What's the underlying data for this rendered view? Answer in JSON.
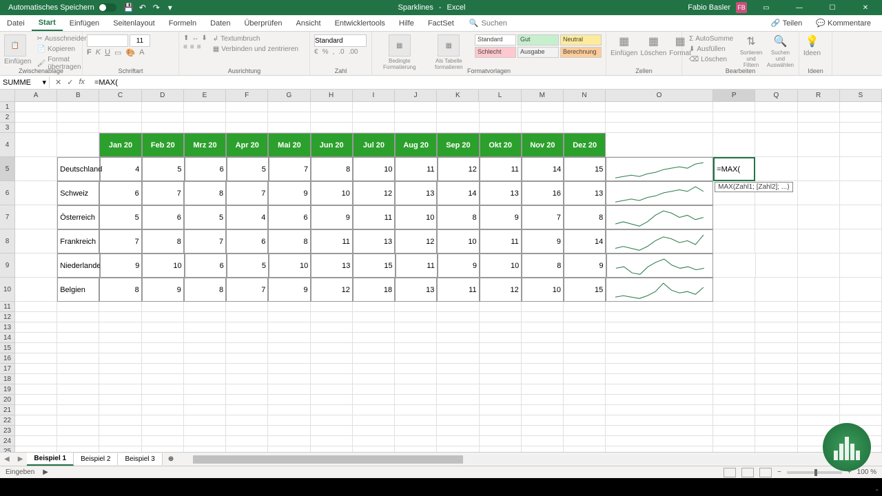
{
  "titlebar": {
    "autosave": "Automatisches Speichern",
    "doc_name": "Sparklines",
    "app_name": "Excel",
    "user_name": "Fabio Basler",
    "user_initials": "FB"
  },
  "ribbon_tabs": [
    "Datei",
    "Start",
    "Einfügen",
    "Seitenlayout",
    "Formeln",
    "Daten",
    "Überprüfen",
    "Ansicht",
    "Entwicklertools",
    "Hilfe",
    "FactSet"
  ],
  "ribbon_active_tab": "Start",
  "ribbon_search": "Suchen",
  "ribbon_share": "Teilen",
  "ribbon_comments": "Kommentare",
  "ribbon_groups": {
    "clipboard": {
      "label": "Zwischenablage",
      "paste": "Einfügen",
      "cut": "Ausschneiden",
      "copy": "Kopieren",
      "format_painter": "Format übertragen"
    },
    "font": {
      "label": "Schriftart",
      "size": "11"
    },
    "alignment": {
      "label": "Ausrichtung",
      "wrap": "Textumbruch",
      "merge": "Verbinden und zentrieren"
    },
    "number": {
      "label": "Zahl",
      "format": "Standard"
    },
    "styles": {
      "label": "Formatvorlagen",
      "conditional": "Bedingte Formatierung",
      "as_table": "Als Tabelle formatieren",
      "standard": "Standard",
      "gut": "Gut",
      "neutral": "Neutral",
      "schlecht": "Schlecht",
      "ausgabe": "Ausgabe",
      "berechnung": "Berechnung"
    },
    "cells": {
      "label": "Zellen",
      "insert": "Einfügen",
      "delete": "Löschen",
      "format": "Format"
    },
    "editing": {
      "label": "Bearbeiten",
      "autosum": "AutoSumme",
      "fill": "Ausfüllen",
      "clear": "Löschen",
      "sort": "Sortieren und Filtern",
      "find": "Suchen und Auswählen"
    },
    "ideas": {
      "label": "Ideen",
      "ideas": "Ideen"
    }
  },
  "name_box": "SUMME",
  "formula": "=MAX(",
  "formula_tooltip": "MAX(Zahl1; [Zahl2]; ...)",
  "columns": [
    "A",
    "B",
    "C",
    "D",
    "E",
    "F",
    "G",
    "H",
    "I",
    "J",
    "K",
    "L",
    "M",
    "N",
    "O",
    "P",
    "Q",
    "R",
    "S"
  ],
  "col_widths": {
    "A": 62,
    "B": 62,
    "C": 62,
    "D": 62,
    "E": 62,
    "F": 62,
    "G": 62,
    "H": 62,
    "I": 62,
    "J": 62,
    "K": 62,
    "L": 62,
    "M": 62,
    "N": 62,
    "O": 158,
    "P": 62,
    "Q": 62,
    "R": 62,
    "S": 62
  },
  "months": [
    "Jan 20",
    "Feb 20",
    "Mrz 20",
    "Apr 20",
    "Mai 20",
    "Jun 20",
    "Jul 20",
    "Aug 20",
    "Sep 20",
    "Okt 20",
    "Nov 20",
    "Dez 20"
  ],
  "chart_data": {
    "type": "line",
    "categories": [
      "Jan 20",
      "Feb 20",
      "Mrz 20",
      "Apr 20",
      "Mai 20",
      "Jun 20",
      "Jul 20",
      "Aug 20",
      "Sep 20",
      "Okt 20",
      "Nov 20",
      "Dez 20"
    ],
    "series": [
      {
        "name": "Deutschland",
        "values": [
          4,
          5,
          6,
          5,
          7,
          8,
          10,
          11,
          12,
          11,
          14,
          15
        ]
      },
      {
        "name": "Schweiz",
        "values": [
          6,
          7,
          8,
          7,
          9,
          10,
          12,
          13,
          14,
          13,
          16,
          13
        ]
      },
      {
        "name": "Österreich",
        "values": [
          5,
          6,
          5,
          4,
          6,
          9,
          11,
          10,
          8,
          9,
          7,
          8
        ]
      },
      {
        "name": "Frankreich",
        "values": [
          7,
          8,
          7,
          6,
          8,
          11,
          13,
          12,
          10,
          11,
          9,
          14
        ]
      },
      {
        "name": "Niederlande",
        "values": [
          9,
          10,
          6,
          5,
          10,
          13,
          15,
          11,
          9,
          10,
          8,
          9
        ]
      },
      {
        "name": "Belgien",
        "values": [
          8,
          9,
          8,
          7,
          9,
          12,
          18,
          13,
          11,
          12,
          10,
          15
        ]
      }
    ]
  },
  "active_cell_value": "=MAX(",
  "sheet_tabs": [
    "Beispiel 1",
    "Beispiel 2",
    "Beispiel 3"
  ],
  "active_sheet": "Beispiel 1",
  "status": "Eingeben",
  "zoom": "100 %"
}
